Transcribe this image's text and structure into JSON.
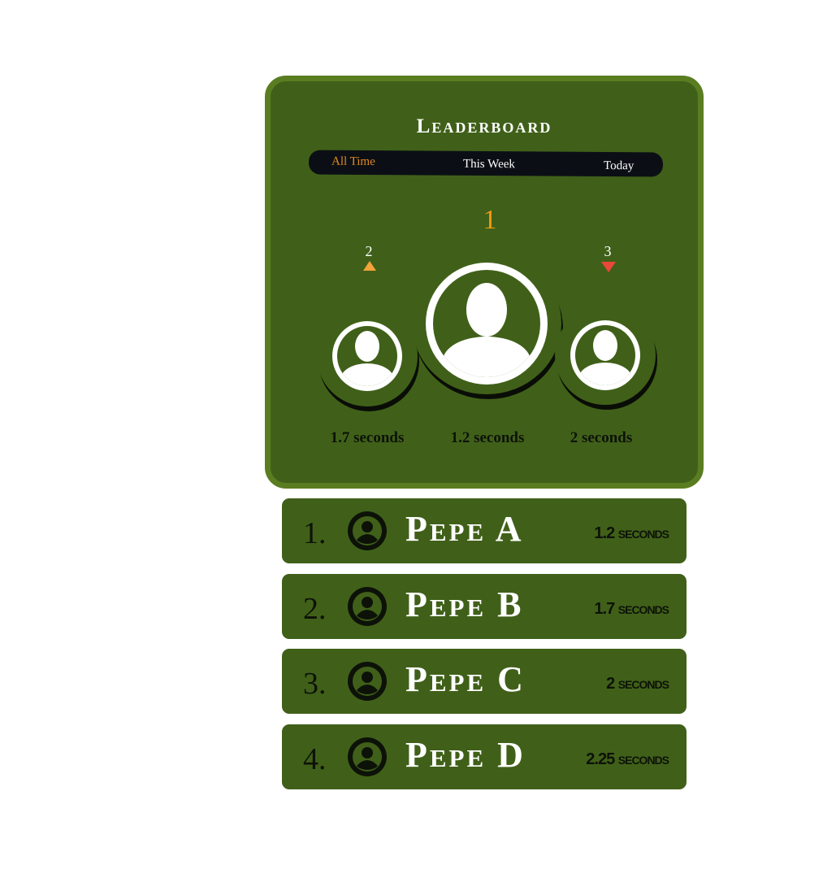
{
  "leaderboard": {
    "title": "Leaderboard",
    "tabs": [
      {
        "label": "All Time",
        "active": true
      },
      {
        "label": "This Week",
        "active": false
      },
      {
        "label": "Today",
        "active": false
      }
    ],
    "podium": {
      "first": {
        "rank": "1",
        "time": "1.2 seconds"
      },
      "second": {
        "rank": "2",
        "time": "1.7 seconds",
        "trend": "up"
      },
      "third": {
        "rank": "3",
        "time": "2 seconds",
        "trend": "down"
      }
    }
  },
  "rows": [
    {
      "rank": "1.",
      "name": "Pepe A",
      "time": "1.2 seconds",
      "icon": "user-circle-icon"
    },
    {
      "rank": "2.",
      "name": "Pepe B",
      "time": "1.7 seconds",
      "icon": "user-circle-icon"
    },
    {
      "rank": "3.",
      "name": "Pepe C",
      "time": "2 seconds",
      "icon": "user-circle-icon"
    },
    {
      "rank": "4.",
      "name": "Pepe D",
      "time": "2.25 seconds",
      "icon": "user-circle-icon"
    }
  ],
  "colors": {
    "card_bg": "#406019",
    "card_border": "#5a7d21",
    "tabbar_bg": "#0b0f15",
    "active_tab": "#e38a1f",
    "first_rank": "#f29a0f",
    "trend_up": "#f2a33a",
    "trend_down": "#e8473a"
  }
}
